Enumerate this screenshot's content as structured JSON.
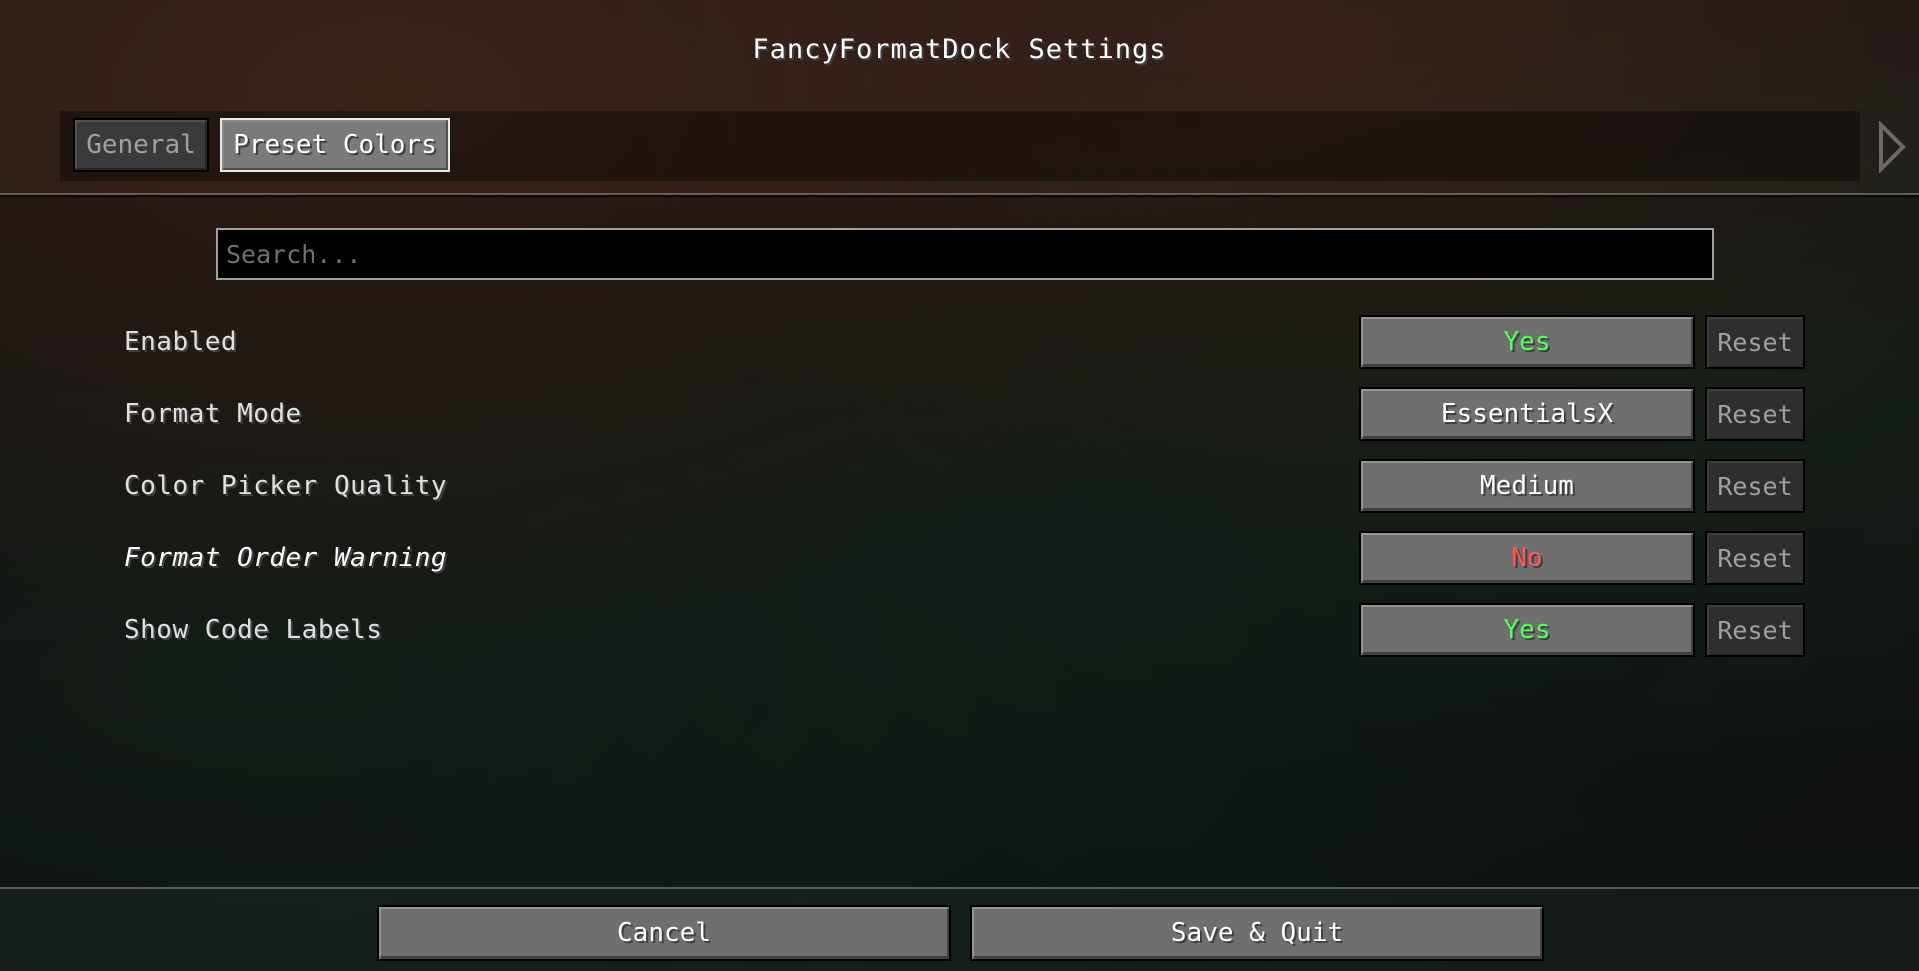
{
  "window": {
    "title": "FancyFormatDock Settings"
  },
  "tabs": [
    {
      "label": "General",
      "selected": false
    },
    {
      "label": "Preset Colors",
      "selected": true
    }
  ],
  "tab_scroll": {
    "icon": "chevron-right-icon"
  },
  "search": {
    "placeholder": "Search...",
    "value": ""
  },
  "options": [
    {
      "label": "Enabled",
      "value": "Yes",
      "value_color": "#55ff55",
      "italic": false,
      "reset_label": "Reset"
    },
    {
      "label": "Format Mode",
      "value": "EssentialsX",
      "value_color": "#ffffff",
      "italic": false,
      "reset_label": "Reset"
    },
    {
      "label": "Color Picker Quality",
      "value": "Medium",
      "value_color": "#ffffff",
      "italic": false,
      "reset_label": "Reset"
    },
    {
      "label": "Format Order Warning",
      "value": "No",
      "value_color": "#ff5555",
      "italic": true,
      "reset_label": "Reset"
    },
    {
      "label": "Show Code Labels",
      "value": "Yes",
      "value_color": "#55ff55",
      "italic": false,
      "reset_label": "Reset"
    }
  ],
  "footer": {
    "cancel_label": "Cancel",
    "save_label": "Save & Quit"
  }
}
